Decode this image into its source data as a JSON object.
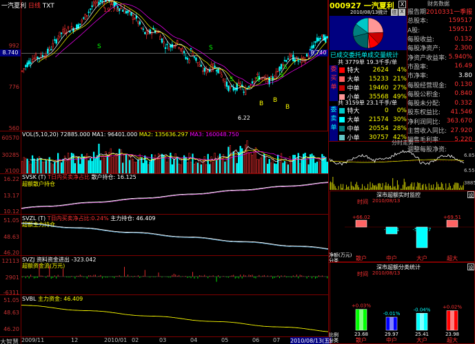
{
  "top": {
    "stock_label": "一汽夏利",
    "period": "日线",
    "suffix": "TXT",
    "code_title": "000927 一汽夏利",
    "date_stat": "2010/08/13统计",
    "btn_zhu": "往",
    "btn_close": "X",
    "finance_title": "财务数据"
  },
  "main_axis": {
    "p992": "992",
    "p8740": "8.740",
    "p776": "776",
    "p560": "560",
    "p8740r": "8.740"
  },
  "main_marks": {
    "low": "6.22",
    "high": "19.70"
  },
  "summary": {
    "title": "已成交委托单成交量统计",
    "buy_head": "共 3779单 19.3千手/单",
    "sell_head": "共 3159单 23.1千手/单",
    "buy_side": "委买单",
    "sell_side": "委卖单",
    "buy": [
      {
        "label": "特大",
        "v": "2624",
        "p": "4%",
        "color": "#ff0000"
      },
      {
        "label": "大单",
        "v": "15233",
        "p": "21%",
        "color": "#ff6464"
      },
      {
        "label": "中单",
        "v": "19460",
        "p": "27%",
        "color": "#c80000"
      },
      {
        "label": "小单",
        "v": "35568",
        "p": "49%",
        "color": "#ff9696"
      }
    ],
    "sell": [
      {
        "label": "特大",
        "v": "0",
        "p": "0%",
        "color": "#00c8c8"
      },
      {
        "label": "大单",
        "v": "21574",
        "p": "30%",
        "color": "#00ffff"
      },
      {
        "label": "中单",
        "v": "20554",
        "p": "28%",
        "color": "#008080"
      },
      {
        "label": "小单",
        "v": "30757",
        "p": "42%",
        "color": "#64c8c8"
      }
    ]
  },
  "finance": {
    "rows": [
      {
        "k": "报告期",
        "v": "2010331一季报",
        "c": "red"
      },
      {
        "k": "总股本:",
        "v": "159517",
        "c": "red"
      },
      {
        "k": "A股:",
        "v": "159517",
        "c": "red"
      },
      {
        "k": "每股收益:",
        "v": "0.132",
        "c": "red"
      },
      {
        "k": "每股净资产:",
        "v": "2.300",
        "c": "red"
      },
      {
        "k": "净资产收益率:",
        "v": "5.940%",
        "c": "red"
      },
      {
        "k": "市盈率:",
        "v": "16.49",
        "c": "red"
      },
      {
        "k": "市净率:",
        "v": "3.80",
        "c": "white"
      },
      {
        "k": "每股经营现金:",
        "v": "0.130",
        "c": "red"
      },
      {
        "k": "每股公积金:",
        "v": "0.840",
        "c": "red"
      },
      {
        "k": "每股未分配:",
        "v": "0.332",
        "c": "red"
      },
      {
        "k": "股东权益比:",
        "v": "41.546",
        "c": "red"
      },
      {
        "k": "净利润同比:",
        "v": "363.670",
        "c": "red"
      },
      {
        "k": "主营收入同比:",
        "v": "27.920",
        "c": "red"
      },
      {
        "k": "销售毛利率:",
        "v": "5.220",
        "c": "red"
      },
      {
        "k": "调整每股净资:",
        "v": "-",
        "c": "red"
      }
    ]
  },
  "vol_panel": {
    "title": "VOL(5,10,20)",
    "t1": "72885.000",
    "t2": "MA1: 96401.000",
    "t3": "MA2: 135636.297",
    "t4": "MA3: 160048.750",
    "ax_top": "60570",
    "ax_mid": "30285",
    "ax_unit": "X100"
  },
  "svsk": {
    "title": "SVSK (T)",
    "desc": "T日内买卖净占比",
    "t1": "散户持仓: 16.125",
    "sub": "超额散户持仓",
    "ax1": "16.22",
    "ax2": "13.17",
    "ax3": "10.12"
  },
  "svzl": {
    "title": "SVZL (T)",
    "desc": "T日内买卖净占比:0.24%",
    "t1": "主力持仓: 46.409",
    "sub": "超额主力持仓",
    "ax1": "51.05",
    "ax2": "48.63",
    "ax3": "46.20"
  },
  "svzj": {
    "title": "SVZJ",
    "desc": "资料资金进出",
    "t1": "-323.042",
    "sub": "超额资金流(万元)",
    "ax1": "12113",
    "ax2": "2901",
    "ax3": "-6311"
  },
  "svbl": {
    "title": "SVBL",
    "t1": "主力资金: 46.409",
    "ax1": "51.05",
    "ax2": "48.63",
    "ax3": "46.20"
  },
  "xaxis": {
    "labels": [
      "2009/11",
      "12",
      "2010/01",
      "02",
      "03",
      "04",
      "05",
      "06",
      "07",
      "2010/08/13(五)"
    ],
    "brand": "大智慧"
  },
  "intraday": {
    "title": "分时走势",
    "ax1": "6.85",
    "ax2": "6.55",
    "ax3": "3885"
  },
  "box1": {
    "title": "深市超额实时监控",
    "time": "时间",
    "date": "2010/08/13",
    "bars": [
      {
        "label": "散户",
        "v": "+66.02",
        "pct": "",
        "val": 66.02,
        "color": "#ff6464"
      },
      {
        "label": "中户",
        "v": "-96.01",
        "pct": "",
        "val": -96.01,
        "color": "#00ffff"
      },
      {
        "label": "大户",
        "v": "-551.07",
        "pct": "",
        "val": -551.07,
        "color": "#00ffff"
      },
      {
        "label": "超大",
        "v": "+69.51",
        "pct": "",
        "val": 69.51,
        "color": "#ff6464"
      }
    ],
    "unit": "净额(万元)",
    "unit2": "分类",
    "set": "设"
  },
  "box2": {
    "title": "深市超额分类统计",
    "time": "时间",
    "date": "2010/08/13",
    "bars": [
      {
        "label": "散户",
        "v": "+0.03%",
        "base": "23.68",
        "val": 0.8,
        "color": "#00ff00"
      },
      {
        "label": "中户",
        "v": "-0.01%",
        "base": "29.97",
        "val": 0.5,
        "color": "#0000ff"
      },
      {
        "label": "大户",
        "v": "-0.04%",
        "base": "25.41",
        "val": 0.65,
        "color": "#00ffff"
      },
      {
        "label": "超大",
        "v": "+0.02%",
        "base": "23.98",
        "val": 0.75,
        "color": "#ff0000"
      }
    ],
    "unit": "比例",
    "unit2": "分类",
    "set": "设"
  }
}
